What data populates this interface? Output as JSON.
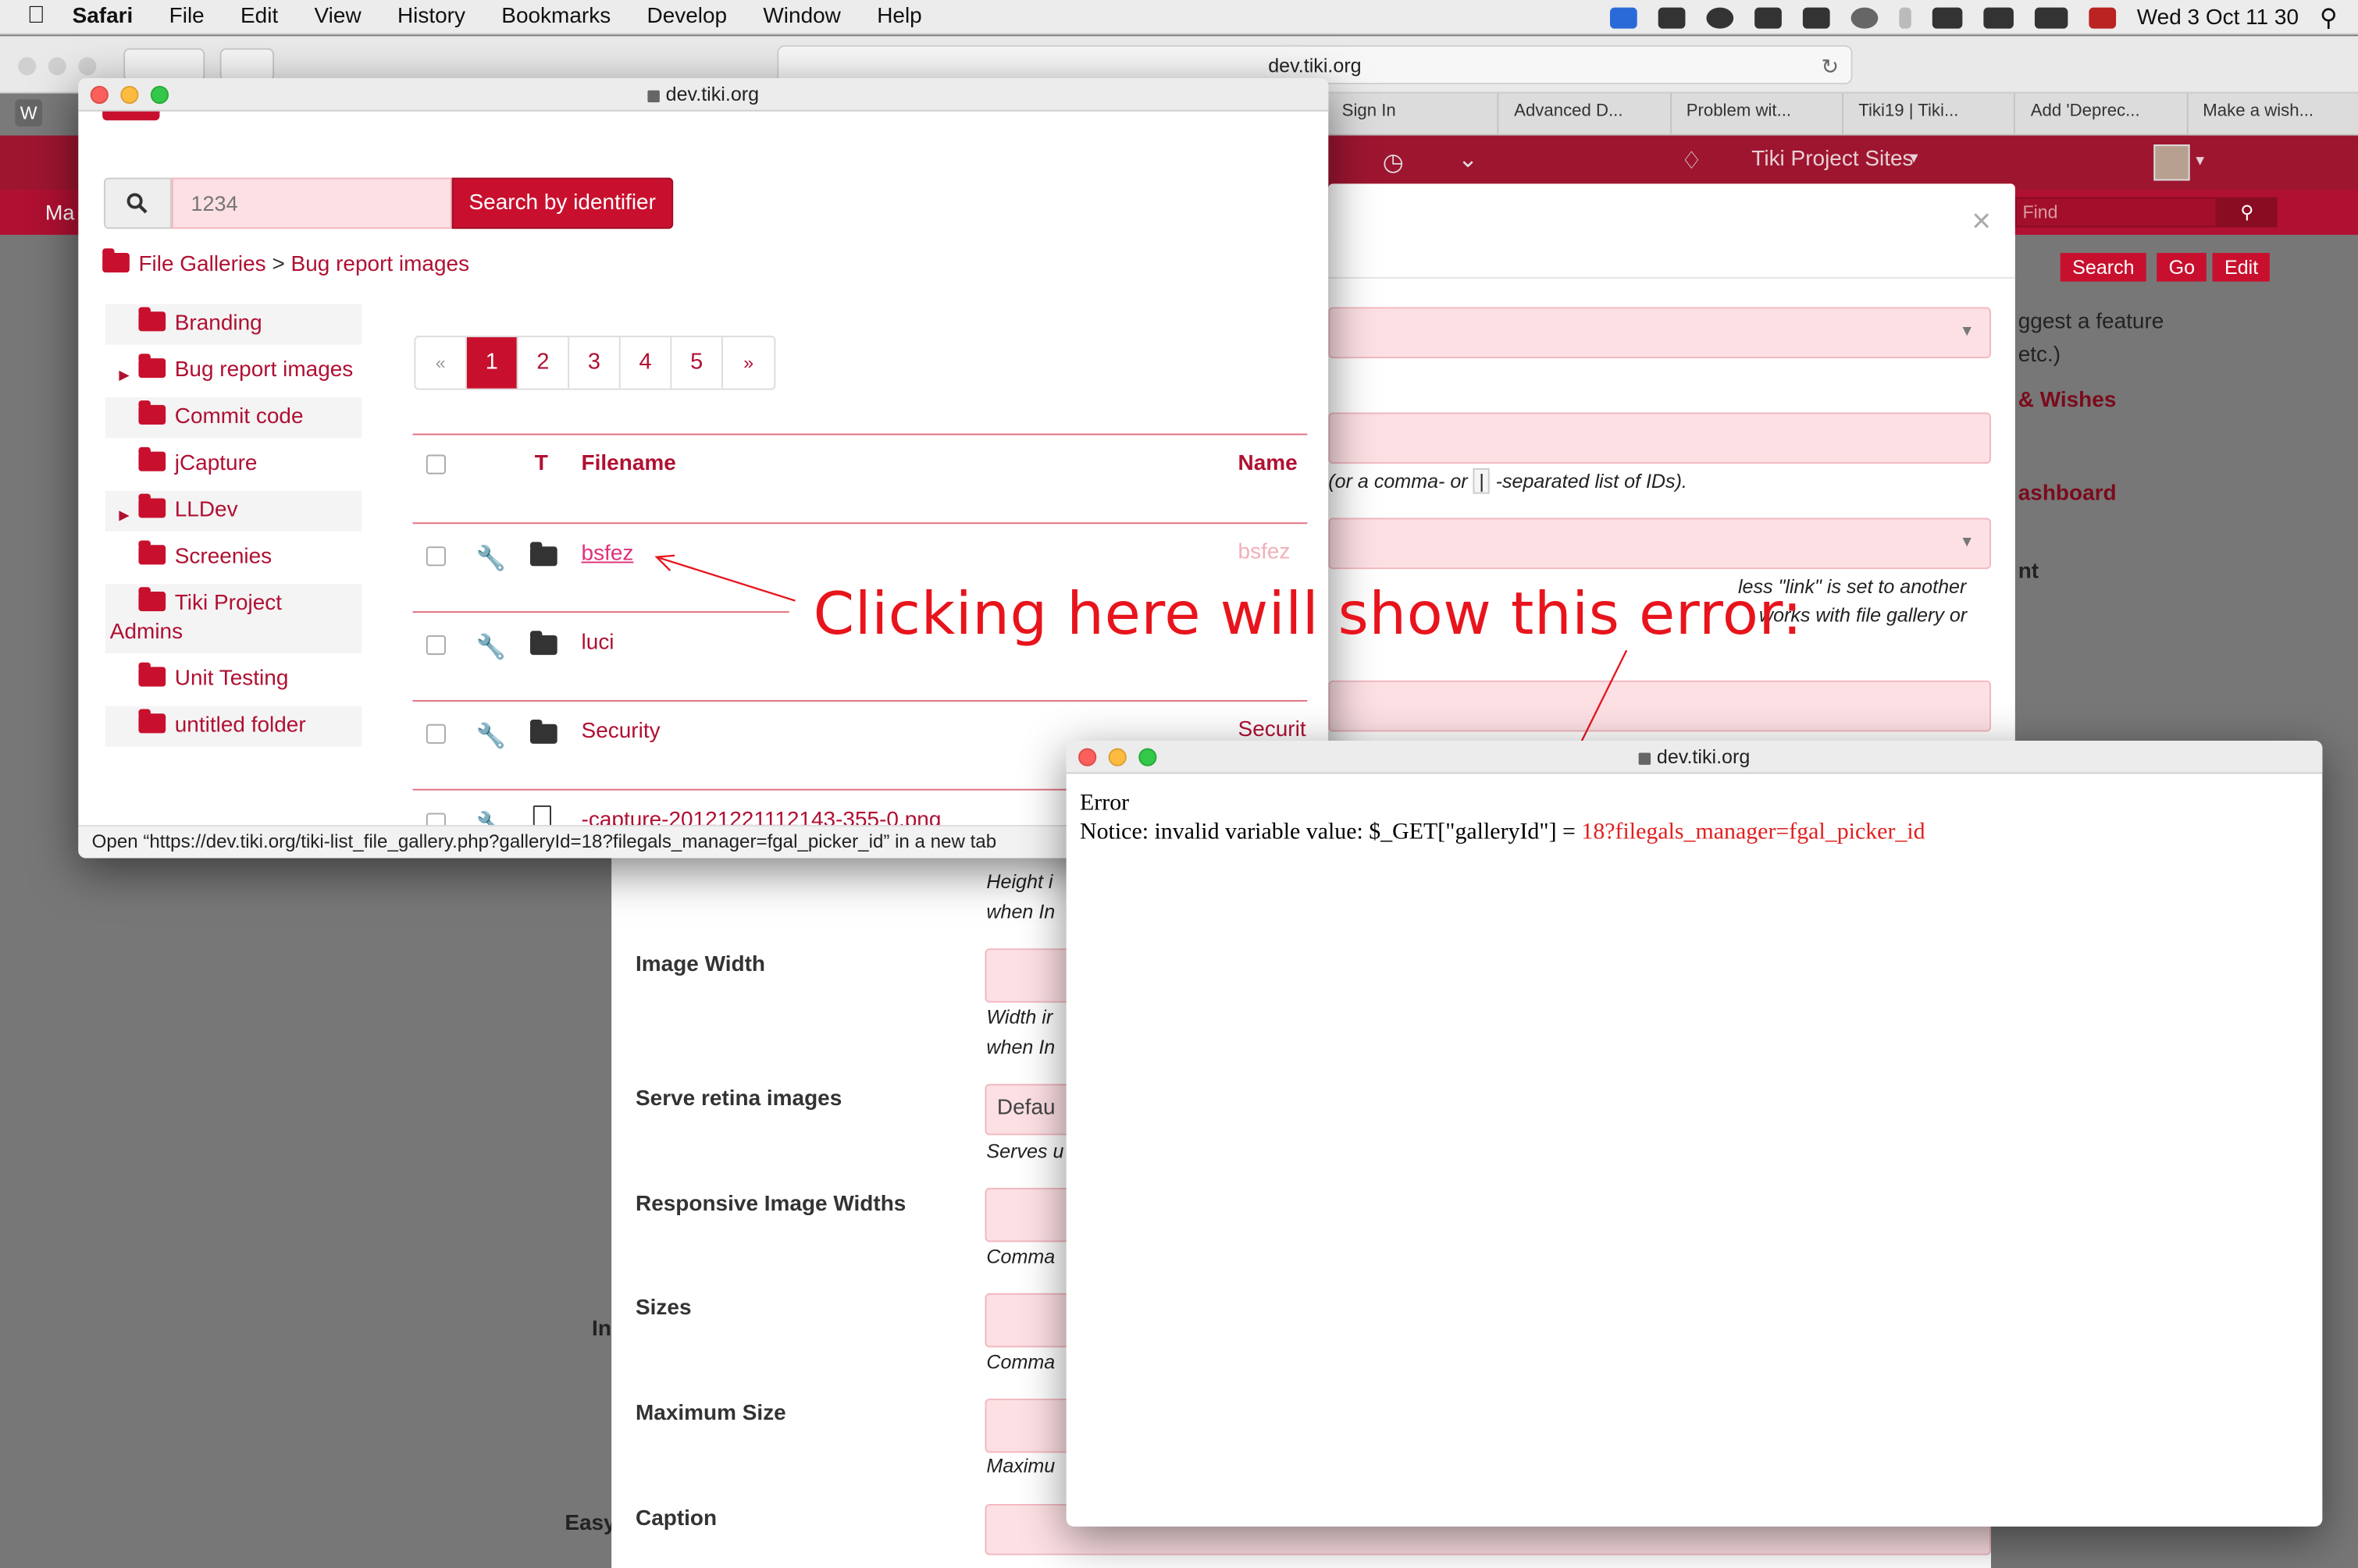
{
  "menubar": {
    "apple": "",
    "app": "Safari",
    "items": [
      "File",
      "Edit",
      "View",
      "History",
      "Bookmarks",
      "Develop",
      "Window",
      "Help"
    ],
    "clock": "Wed 3 Oct  11 30"
  },
  "browser": {
    "address": "dev.tiki.org",
    "tabs": [
      "Sign In",
      "Advanced D...",
      "Problem wit...",
      "Tiki19 | Tiki...",
      "Add 'Deprec...",
      "Make a wish..."
    ]
  },
  "background": {
    "header_sites": "Tiki Project Sites",
    "find_placeholder": "Find",
    "buttons": [
      "Search",
      "Go",
      "Edit"
    ],
    "right_text": [
      "ggest a feature",
      "etc.)",
      "& Wishes",
      "ashboard",
      "nt"
    ],
    "modal_hint1": "(or a comma- or",
    "modal_pipe": "|",
    "modal_hint1b": "-separated list of IDs).",
    "modal_hint2": "less \"link\" is set to another",
    "modal_hint3": "works with file gallery or",
    "form_labels": [
      "Image Width",
      "Serve retina images",
      "Responsive Image Widths",
      "Sizes",
      "Maximum Size",
      "Caption"
    ],
    "form_hints": [
      "Height i",
      "when In",
      "Width ir",
      "when In",
      "Serves u",
      "Comma",
      "Comma",
      "Maximu"
    ],
    "form_default": "Defau",
    "left_partials": [
      "Ma",
      "In",
      "Easy"
    ]
  },
  "popup_gallery": {
    "title": "dev.tiki.org",
    "search_placeholder": "1234",
    "search_button": "Search by identifier",
    "breadcrumb": {
      "root": "File Galleries",
      "sep": ">",
      "current": "Bug report images"
    },
    "tree": [
      {
        "label": "Branding",
        "caret": false
      },
      {
        "label": "Bug report images",
        "caret": true
      },
      {
        "label": "Commit code",
        "caret": false
      },
      {
        "label": "jCapture",
        "caret": false
      },
      {
        "label": "LLDev",
        "caret": true
      },
      {
        "label": "Screenies",
        "caret": false
      },
      {
        "label": "Tiki Project Admins",
        "caret": false
      },
      {
        "label": "Unit Testing",
        "caret": false
      },
      {
        "label": "untitled folder",
        "caret": false
      }
    ],
    "pager": [
      "«",
      "1",
      "2",
      "3",
      "4",
      "5",
      "»"
    ],
    "columns": {
      "type": "T",
      "filename": "Filename",
      "name": "Name"
    },
    "rows": [
      {
        "filename": "bsfez",
        "name": "bsfez"
      },
      {
        "filename": "luci",
        "name": ""
      },
      {
        "filename": "Security",
        "name": "Securit"
      },
      {
        "filename": "-capture-20121221112143-355-0.png",
        "name": ""
      }
    ],
    "status_url": "Open “https://dev.tiki.org/tiki-list_file_gallery.php?galleryId=18?filegals_manager=fgal_picker_id” in a new tab"
  },
  "annotation": "Clicking here will show this error:",
  "popup_error": {
    "title": "dev.tiki.org",
    "heading": "Error",
    "notice": "Notice: invalid variable value: $_GET[\"galleryId\"] = ",
    "value": "18?filegals_manager=fgal_picker_id"
  }
}
